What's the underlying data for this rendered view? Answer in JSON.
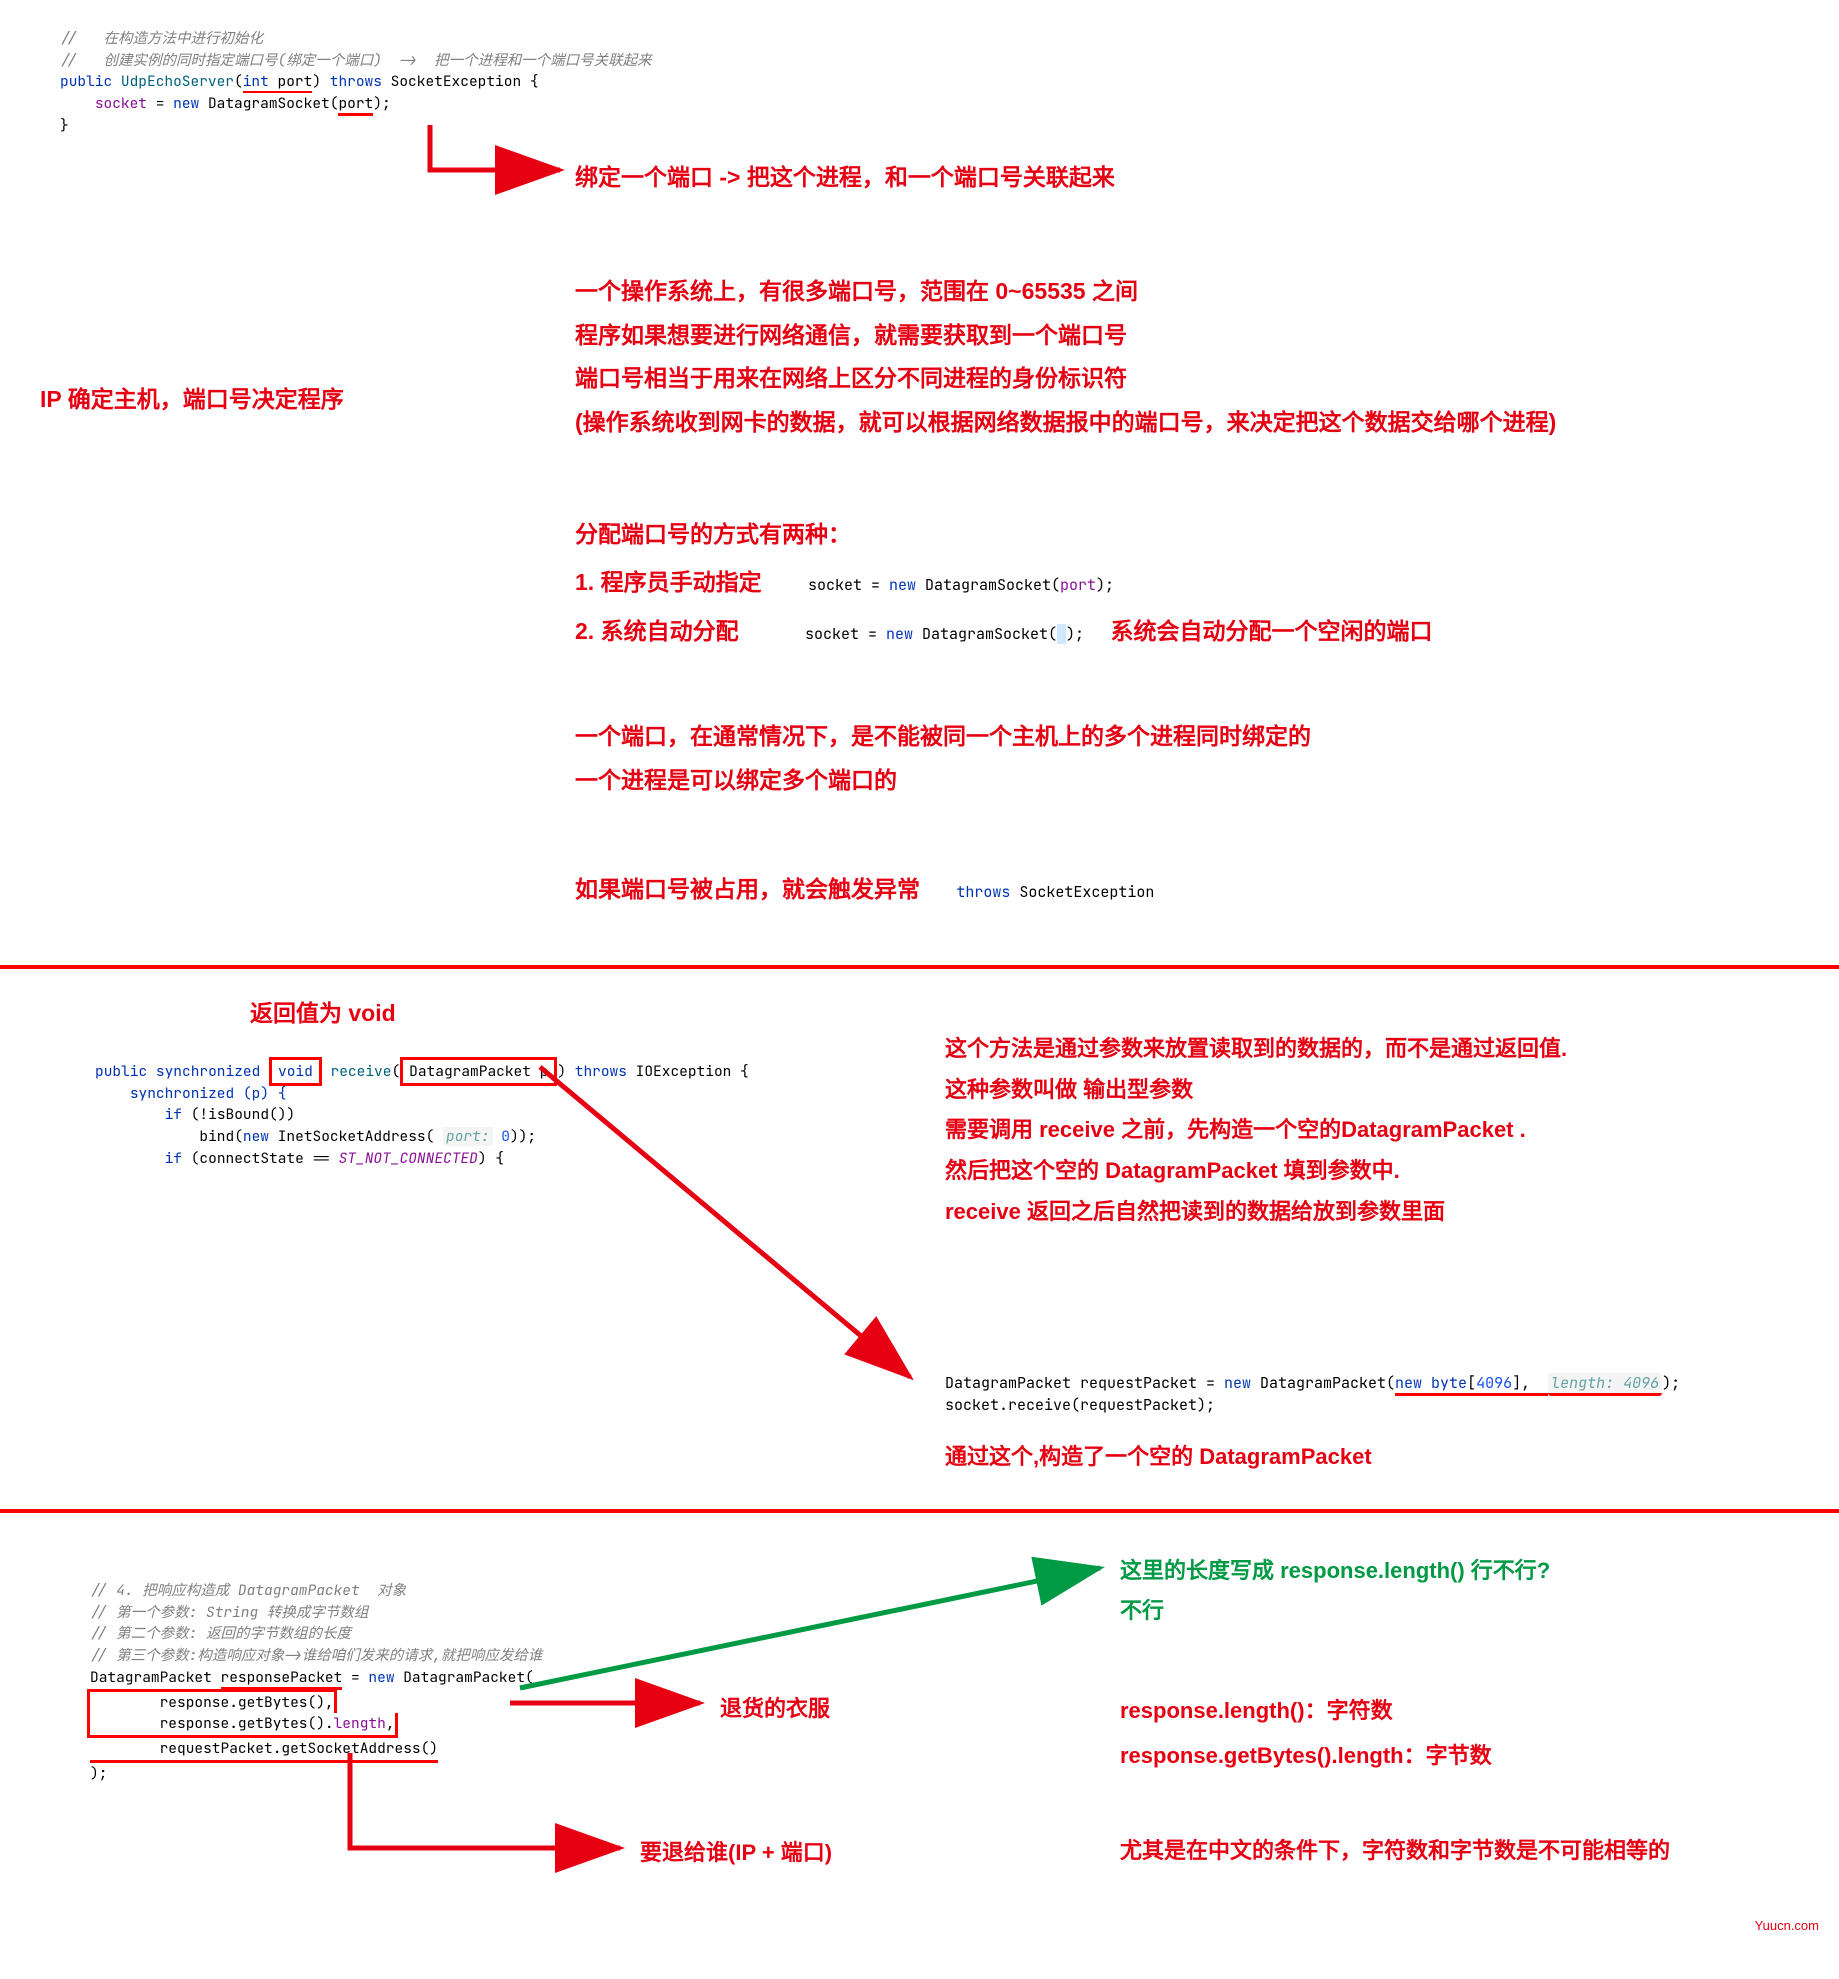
{
  "s1": {
    "code": {
      "c1": "//   在构造方法中进行初始化",
      "c2": "//   创建实例的同时指定端口号(绑定一个端口)  ->  把一个进程和一个端口号关联起来",
      "l1_public": "public",
      "l1_cls": "UdpEchoServer",
      "l1_int": "int",
      "l1_port": "port",
      "l1_throws": "throws",
      "l1_ex": "SocketException",
      "l2_socket": "socket",
      "l2_new": "new",
      "l2_ds": "DatagramSocket",
      "l2_port": "port"
    },
    "ann": {
      "a1": "绑定一个端口 -> 把这个进程，和一个端口号关联起来",
      "left": "IP 确定主机，端口号决定程序",
      "p1": "一个操作系统上，有很多端口号，范围在 0~65535 之间",
      "p2": "程序如果想要进行网络通信，就需要获取到一个端口号",
      "p3": "端口号相当于用来在网络上区分不同进程的身份标识符",
      "p4": "(操作系统收到网卡的数据，就可以根据网络数据报中的端口号，来决定把这个数据交给哪个进程)",
      "p5": "分配端口号的方式有两种：",
      "p6": "1. 程序员手动指定",
      "p7": "2. 系统自动分配",
      "p7b": "系统会自动分配一个空闲的端口",
      "p8": "一个端口，在通常情况下，是不能被同一个主机上的多个进程同时绑定的",
      "p9": "一个进程是可以绑定多个端口的",
      "p10": "如果端口号被占用，就会触发异常"
    },
    "inline1": {
      "pre": "socket = ",
      "kw": "new",
      "cls": " DatagramSocket(",
      "var": "port",
      "post": ");"
    },
    "inline2": {
      "pre": "socket = ",
      "kw": "new",
      "cls": " DatagramSocket(",
      "post": ");"
    },
    "inline3": {
      "kw": "throws",
      "cls": " SocketException"
    }
  },
  "s2": {
    "title": "返回值为 void",
    "code": {
      "l1_public": "public synchronized",
      "l1_void": "void",
      "l1_rec": "receive",
      "l1_dp": "DatagramPacket p",
      "l1_throws": "throws",
      "l1_ex": "IOException",
      "l2": "synchronized (p) {",
      "l3_if": "if",
      "l3_cond": "(!isBound())",
      "l4_bind": "bind(",
      "l4_new": "new",
      "l4_isa": "InetSocketAddress( ",
      "l4_hint": "port:",
      "l4_zero": "0",
      "l4_end": "));",
      "l5_if": "if",
      "l5_cond": "(connectState == ",
      "l5_const": "ST_NOT_CONNECTED",
      "l5_end": ") {"
    },
    "ann": {
      "a1": "这个方法是通过参数来放置读取到的数据的，而不是通过返回值.",
      "a2": "这种参数叫做 输出型参数",
      "a3": "需要调用 receive 之前，先构造一个空的DatagramPacket .",
      "a4": "然后把这个空的 DatagramPacket 填到参数中.",
      "a5": "receive 返回之后自然把读到的数据给放到参数里面",
      "a6": "通过这个,构造了一个空的 DatagramPacket"
    },
    "inline": {
      "p1a": "DatagramPacket requestPacket = ",
      "p1b": "new",
      "p1c": " DatagramPacket(",
      "p1d": "new byte",
      "p1e": "[",
      "p1f": "4096",
      "p1g": "],  ",
      "p1h": "length:",
      "p1i": " 4096",
      "p1j": ");",
      "p2": "socket.receive(requestPacket);"
    }
  },
  "s3": {
    "code": {
      "c1": "// 4. 把响应构造成 DatagramPacket  对象",
      "c2": "// 第一个参数: String 转换成字节数组",
      "c3": "// 第二个参数: 返回的字节数组的长度",
      "c4": "// 第三个参数:构造响应对象->谁给咱们发来的请求,就把响应发给谁",
      "l1a": "DatagramPacket ",
      "l1b": "responsePacket",
      "l1c": " = ",
      "l1d": "new",
      "l1e": " DatagramPacket(",
      "l2": "        response.getBytes(),",
      "l3": "        response.getBytes().",
      "l3b": "length",
      "l3c": ",",
      "l4": "        requestPacket.getSocketAddress()",
      "l5": ");"
    },
    "ann": {
      "g1": "这里的长度写成 response.length() 行不行?",
      "g2": "不行",
      "r1": "退货的衣服",
      "r2": "要退给谁(IP + 端口)",
      "r3": "response.length()：字符数",
      "r4": "response.getBytes().length：字节数",
      "r5": "尤其是在中文的条件下，字符数和字节数是不可能相等的"
    }
  },
  "footer": "Yuucn.com"
}
